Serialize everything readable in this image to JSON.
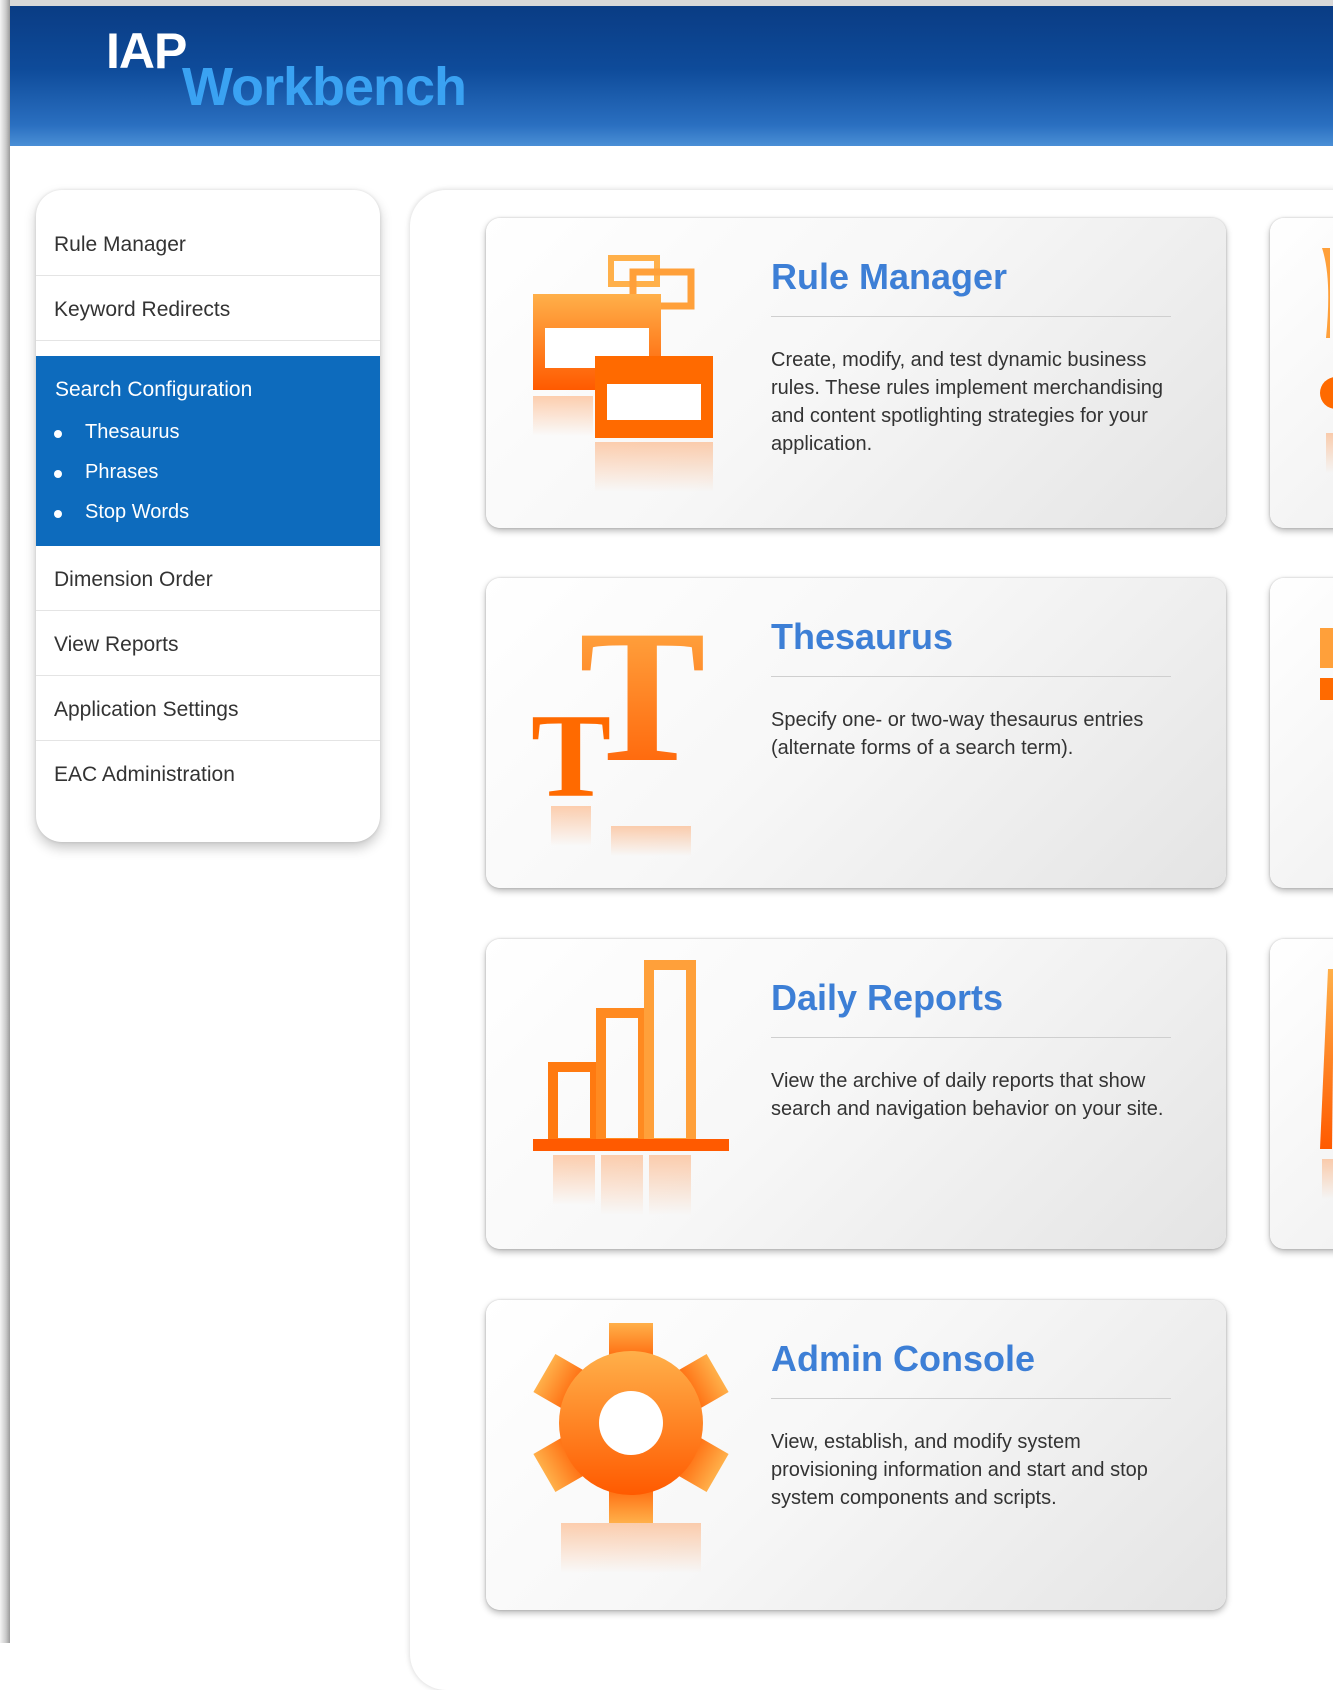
{
  "header": {
    "logo_top": "IAP",
    "logo_bottom": "Workbench"
  },
  "sidebar": {
    "items": [
      {
        "label": "Rule Manager"
      },
      {
        "label": "Keyword Redirects"
      },
      {
        "label": "Search Configuration",
        "active": true,
        "children": [
          "Thesaurus",
          "Phrases",
          "Stop Words"
        ]
      },
      {
        "label": "Dimension Order"
      },
      {
        "label": "View Reports"
      },
      {
        "label": "Application Settings"
      },
      {
        "label": "EAC Administration"
      }
    ]
  },
  "cards": [
    {
      "title": "Rule Manager",
      "description": "Create, modify, and test dynamic business rules. These rules implement merchandising and content spotlighting strategies for your application.",
      "icon": "windows-stack-icon"
    },
    {
      "title": "Thesaurus",
      "description": "Specify one- or two-way thesaurus entries (alternate forms of a search term).",
      "icon": "text-size-icon"
    },
    {
      "title": "Daily Reports",
      "description": "View the archive of daily reports that show search and navigation behavior on your site.",
      "icon": "bar-chart-icon"
    },
    {
      "title": "Admin Console",
      "description": "View, establish, and modify system provisioning information and start and stop system components and scripts.",
      "icon": "gear-icon"
    }
  ],
  "colors": {
    "header_blue": "#0e4b9a",
    "logo_accent": "#3aa2f2",
    "nav_active": "#0d6bbd",
    "card_title": "#3d7fd6",
    "icon_orange": "#ff6a00"
  }
}
